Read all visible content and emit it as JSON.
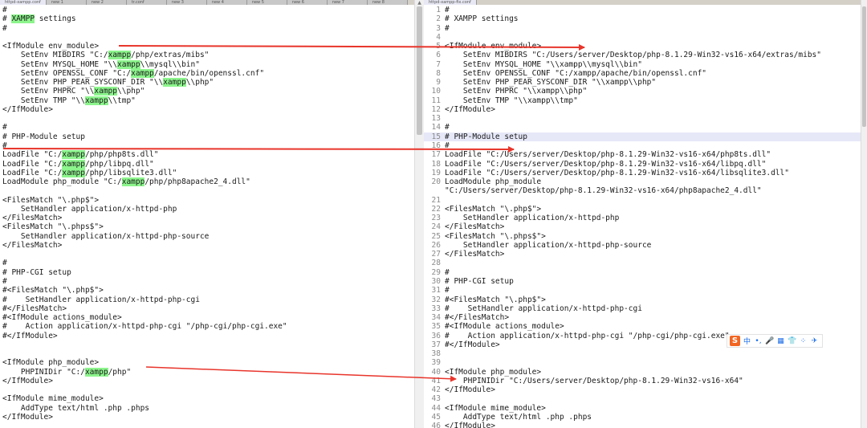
{
  "left_tabs": [
    "httpd-xampp.conf",
    "new 1",
    "new 2",
    "tr.conf",
    "new 3",
    "new 4",
    "new 5",
    "new 6",
    "new 7",
    "new 8"
  ],
  "right_tabs": [
    "httpd-xampp-fix.conf"
  ],
  "left_lines": [
    [
      {
        "t": "#"
      }
    ],
    [
      {
        "t": "# "
      },
      {
        "t": "XAMPP",
        "m": true
      },
      {
        "t": " settings"
      }
    ],
    [
      {
        "t": "#"
      }
    ],
    [
      {
        "t": ""
      }
    ],
    [
      {
        "t": "<IfModule env_module>"
      }
    ],
    [
      {
        "t": "    SetEnv MIBDIRS \"C:/"
      },
      {
        "t": "xampp",
        "m": true
      },
      {
        "t": "/php/extras/mibs\""
      }
    ],
    [
      {
        "t": "    SetEnv MYSQL_HOME \"\\\\"
      },
      {
        "t": "xampp",
        "m": true
      },
      {
        "t": "\\\\mysql\\\\bin\""
      }
    ],
    [
      {
        "t": "    SetEnv OPENSSL_CONF \"C:/"
      },
      {
        "t": "xampp",
        "m": true
      },
      {
        "t": "/apache/bin/openssl.cnf\""
      }
    ],
    [
      {
        "t": "    SetEnv PHP_PEAR_SYSCONF_DIR \"\\\\"
      },
      {
        "t": "xampp",
        "m": true
      },
      {
        "t": "\\\\php\""
      }
    ],
    [
      {
        "t": "    SetEnv PHPRC \"\\\\"
      },
      {
        "t": "xampp",
        "m": true
      },
      {
        "t": "\\\\php\""
      }
    ],
    [
      {
        "t": "    SetEnv TMP \"\\\\"
      },
      {
        "t": "xampp",
        "m": true
      },
      {
        "t": "\\\\tmp\""
      }
    ],
    [
      {
        "t": "</IfModule>"
      }
    ],
    [
      {
        "t": ""
      }
    ],
    [
      {
        "t": "#"
      }
    ],
    [
      {
        "t": "# PHP-Module setup"
      }
    ],
    [
      {
        "t": "#"
      }
    ],
    [
      {
        "t": "LoadFile \"C:/"
      },
      {
        "t": "xampp",
        "m": true
      },
      {
        "t": "/php/php8ts.dll\""
      }
    ],
    [
      {
        "t": "LoadFile \"C:/"
      },
      {
        "t": "xampp",
        "m": true
      },
      {
        "t": "/php/libpq.dll\""
      }
    ],
    [
      {
        "t": "LoadFile \"C:/"
      },
      {
        "t": "xampp",
        "m": true
      },
      {
        "t": "/php/libsqlite3.dll\""
      }
    ],
    [
      {
        "t": "LoadModule php_module \"C:/"
      },
      {
        "t": "xampp",
        "m": true
      },
      {
        "t": "/php/php8apache2_4.dll\""
      }
    ],
    [
      {
        "t": ""
      }
    ],
    [
      {
        "t": "<FilesMatch \"\\.php$\">"
      }
    ],
    [
      {
        "t": "    SetHandler application/x-httpd-php"
      }
    ],
    [
      {
        "t": "</FilesMatch>"
      }
    ],
    [
      {
        "t": "<FilesMatch \"\\.phps$\">"
      }
    ],
    [
      {
        "t": "    SetHandler application/x-httpd-php-source"
      }
    ],
    [
      {
        "t": "</FilesMatch>"
      }
    ],
    [
      {
        "t": ""
      }
    ],
    [
      {
        "t": "#"
      }
    ],
    [
      {
        "t": "# PHP-CGI setup"
      }
    ],
    [
      {
        "t": "#"
      }
    ],
    [
      {
        "t": "#<FilesMatch \"\\.php$\">"
      }
    ],
    [
      {
        "t": "#    SetHandler application/x-httpd-php-cgi"
      }
    ],
    [
      {
        "t": "#</FilesMatch>"
      }
    ],
    [
      {
        "t": "#<IfModule actions_module>"
      }
    ],
    [
      {
        "t": "#    Action application/x-httpd-php-cgi \"/php-cgi/php-cgi.exe\""
      }
    ],
    [
      {
        "t": "#</IfModule>"
      }
    ],
    [
      {
        "t": ""
      }
    ],
    [
      {
        "t": ""
      }
    ],
    [
      {
        "t": "<IfModule php_module>"
      }
    ],
    [
      {
        "t": "    PHPINIDir \"C:/"
      },
      {
        "t": "xampp",
        "m": true
      },
      {
        "t": "/php\""
      }
    ],
    [
      {
        "t": "</IfModule>"
      }
    ],
    [
      {
        "t": ""
      }
    ],
    [
      {
        "t": "<IfModule mime_module>"
      }
    ],
    [
      {
        "t": "    AddType text/html .php .phps"
      }
    ],
    [
      {
        "t": "</IfModule>"
      }
    ]
  ],
  "right_lines": [
    {
      "n": "1",
      "t": "#"
    },
    {
      "n": "2",
      "t": "# XAMPP settings"
    },
    {
      "n": "3",
      "t": "#"
    },
    {
      "n": "4",
      "t": ""
    },
    {
      "n": "5",
      "t": "<IfModule env_module>"
    },
    {
      "n": "6",
      "t": "    SetEnv MIBDIRS \"C:/Users/server/Desktop/php-8.1.29-Win32-vs16-x64/extras/mibs\""
    },
    {
      "n": "7",
      "t": "    SetEnv MYSQL_HOME \"\\\\xampp\\\\mysql\\\\bin\""
    },
    {
      "n": "8",
      "t": "    SetEnv OPENSSL_CONF \"C:/xampp/apache/bin/openssl.cnf\""
    },
    {
      "n": "9",
      "t": "    SetEnv PHP_PEAR_SYSCONF_DIR \"\\\\xampp\\\\php\""
    },
    {
      "n": "10",
      "t": "    SetEnv PHPRC \"\\\\xampp\\\\php\""
    },
    {
      "n": "11",
      "t": "    SetEnv TMP \"\\\\xampp\\\\tmp\""
    },
    {
      "n": "12",
      "t": "</IfModule>"
    },
    {
      "n": "13",
      "t": ""
    },
    {
      "n": "14",
      "t": "#"
    },
    {
      "n": "15",
      "t": "# PHP-Module setup",
      "hl": true
    },
    {
      "n": "16",
      "t": "#"
    },
    {
      "n": "17",
      "t": "LoadFile \"C:/Users/server/Desktop/php-8.1.29-Win32-vs16-x64/php8ts.dll\""
    },
    {
      "n": "18",
      "t": "LoadFile \"C:/Users/server/Desktop/php-8.1.29-Win32-vs16-x64/libpq.dll\""
    },
    {
      "n": "19",
      "t": "LoadFile \"C:/Users/server/Desktop/php-8.1.29-Win32-vs16-x64/libsqlite3.dll\""
    },
    {
      "n": "20",
      "t": "LoadModule php_module"
    },
    {
      "n": "",
      "t": "\"C:/Users/server/Desktop/php-8.1.29-Win32-vs16-x64/php8apache2_4.dll\""
    },
    {
      "n": "21",
      "t": ""
    },
    {
      "n": "22",
      "t": "<FilesMatch \"\\.php$\">"
    },
    {
      "n": "23",
      "t": "    SetHandler application/x-httpd-php"
    },
    {
      "n": "24",
      "t": "</FilesMatch>"
    },
    {
      "n": "25",
      "t": "<FilesMatch \"\\.phps$\">"
    },
    {
      "n": "26",
      "t": "    SetHandler application/x-httpd-php-source"
    },
    {
      "n": "27",
      "t": "</FilesMatch>"
    },
    {
      "n": "28",
      "t": ""
    },
    {
      "n": "29",
      "t": "#"
    },
    {
      "n": "30",
      "t": "# PHP-CGI setup"
    },
    {
      "n": "31",
      "t": "#"
    },
    {
      "n": "32",
      "t": "#<FilesMatch \"\\.php$\">"
    },
    {
      "n": "33",
      "t": "#    SetHandler application/x-httpd-php-cgi"
    },
    {
      "n": "34",
      "t": "#</FilesMatch>"
    },
    {
      "n": "35",
      "t": "#<IfModule actions_module>"
    },
    {
      "n": "36",
      "t": "#    Action application/x-httpd-php-cgi \"/php-cgi/php-cgi.exe\""
    },
    {
      "n": "37",
      "t": "#</IfModule>"
    },
    {
      "n": "38",
      "t": ""
    },
    {
      "n": "39",
      "t": ""
    },
    {
      "n": "40",
      "t": "<IfModule php_module>"
    },
    {
      "n": "41",
      "t": "    PHPINIDir \"C:/Users/server/Desktop/php-8.1.29-Win32-vs16-x64\""
    },
    {
      "n": "42",
      "t": "</IfModule>"
    },
    {
      "n": "43",
      "t": ""
    },
    {
      "n": "44",
      "t": "<IfModule mime_module>"
    },
    {
      "n": "45",
      "t": "    AddType text/html .php .phps"
    },
    {
      "n": "46",
      "t": "</IfModule>"
    }
  ],
  "ime_toolbar": {
    "logo": "S",
    "items": [
      "中",
      "•,",
      "🎤",
      "▦",
      "👕",
      "⁘",
      "✈"
    ]
  },
  "colors": {
    "search_highlight": "#8cf58c",
    "current_line": "#e6e8f8",
    "arrow": "#e8352b",
    "ime_brand": "#f26522"
  }
}
